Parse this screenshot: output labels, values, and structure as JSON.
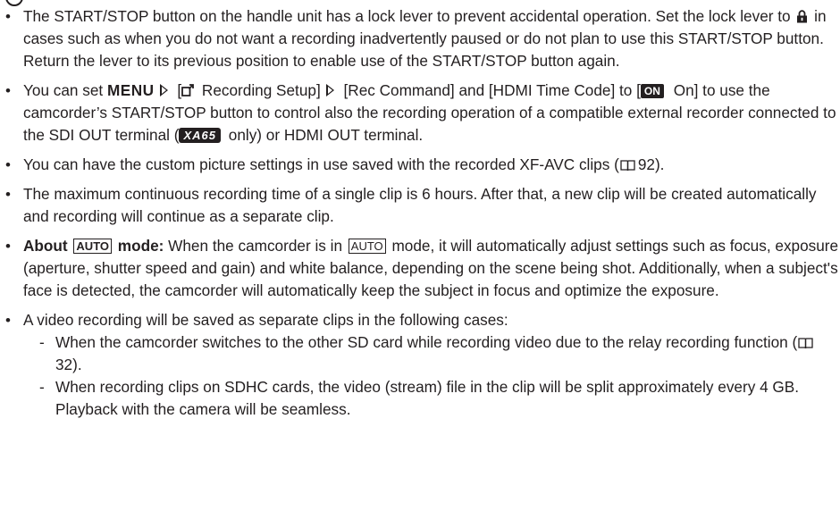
{
  "notes": [
    {
      "t1": "The START/STOP button on the handle unit has a lock lever to prevent accidental operation. Set the lock lever to ",
      "t2": " in cases such as when you do not want a recording inadvertently paused or do not plan to use this START/STOP button. Return the lever to its previous position to enable use of the START/STOP button again."
    },
    {
      "t1": "You can set ",
      "menu": "MENU",
      "t2": " [",
      "t3": " Recording Setup]",
      "t4": " [Rec Command] and [HDMI Time Code] to [",
      "on_badge": "ON",
      "t5": " On] to use the camcorder’s START/STOP button to control also the recording operation of a compatible external recorder connected to the SDI OUT terminal (",
      "model_badge": "XA65",
      "t6": " only) or HDMI OUT terminal."
    },
    {
      "t1": "You can have the custom picture settings in use saved with the recorded XF-AVC clips (",
      "page_ref": "92",
      "t2": ")."
    },
    {
      "t1": "The maximum continuous recording time of a single clip is 6 hours. After that, a new clip will be created automatically and recording will continue as a separate clip."
    },
    {
      "about_1": "About ",
      "auto_badge": "AUTO",
      "about_2": " mode:",
      "t1": " When the camcorder is in ",
      "t2": " mode, it will automatically adjust settings such as focus, exposure (aperture, shutter speed and gain) and white balance, depending on the scene being shot. Additionally, when a subject's face is detected, the camcorder will automatically keep the subject in focus and optimize the exposure."
    },
    {
      "t1": "A video recording will be saved as separate clips in the following cases:",
      "sub": [
        {
          "t1": "When the camcorder switches to the other SD card while recording video due to the relay recording function (",
          "page_ref": "32",
          "t2": ")."
        },
        {
          "t1": "When recording clips on SDHC cards, the video (stream) file in the clip will be split approximately every 4 GB.",
          "t2": "Playback with the camera will be seamless."
        }
      ]
    }
  ],
  "icons": {
    "lock": "lock-icon",
    "arrow": "arrow-right-icon",
    "camera": "camera-setup-icon",
    "book": "page-reference-icon"
  }
}
